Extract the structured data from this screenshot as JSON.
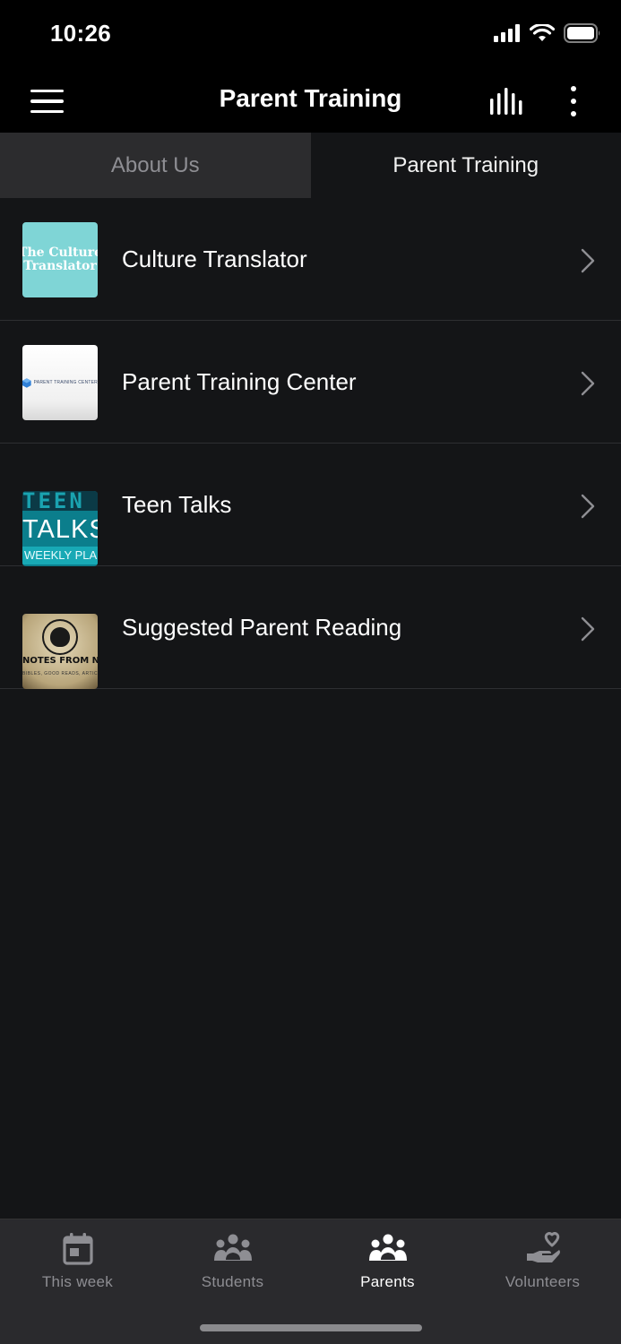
{
  "status_bar": {
    "time": "10:26"
  },
  "header": {
    "title": "Parent Training"
  },
  "tabs": [
    {
      "label": "About Us",
      "active": false
    },
    {
      "label": "Parent Training",
      "active": true
    }
  ],
  "list": [
    {
      "label": "Culture Translator",
      "thumb_text": [
        "The Culture",
        "Translator"
      ]
    },
    {
      "label": "Parent Training Center",
      "thumb_text": [
        "PARENT TRAINING CENTER"
      ]
    },
    {
      "label": "Teen Talks",
      "thumb_text": [
        "TEEN",
        "TALKS",
        "WEEKLY PLAN"
      ]
    },
    {
      "label": "Suggested Parent Reading",
      "thumb_text": [
        "NOTES FROM NATHAN",
        "BIBLES, GOOD READS, ARTICLES & MORE"
      ]
    }
  ],
  "bottom_nav": [
    {
      "label": "This week",
      "icon": "calendar-icon",
      "active": false
    },
    {
      "label": "Students",
      "icon": "group-icon",
      "active": false
    },
    {
      "label": "Parents",
      "icon": "group-icon",
      "active": true
    },
    {
      "label": "Volunteers",
      "icon": "hand-heart-icon",
      "active": false
    }
  ],
  "colors": {
    "background": "#141517",
    "header": "#000000",
    "tab_inactive": "#2c2c2e",
    "nav_bg": "#2a2a2d",
    "nav_inactive": "#8e8e93",
    "nav_active": "#ffffff"
  }
}
